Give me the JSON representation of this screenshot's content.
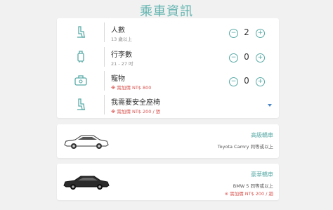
{
  "page": {
    "title": "乘車資訊"
  },
  "options": {
    "passengers": {
      "label": "人數",
      "sub": "13 歲以上",
      "value": "2",
      "minus": "−",
      "plus": "+",
      "icon": "car-seat-icon"
    },
    "luggage": {
      "label": "行李數",
      "sub": "21 - 27 吋",
      "value": "0",
      "minus": "−",
      "plus": "+",
      "icon": "luggage-icon"
    },
    "pets": {
      "label": "寵物",
      "note_mark": "※",
      "note": "需加價 NT$ 800",
      "value": "0",
      "minus": "−",
      "plus": "+",
      "icon": "pet-carrier-icon"
    },
    "child_seat": {
      "label": "我需要安全座椅",
      "note_mark": "※",
      "note": "需加價 NT$ 200 / 張",
      "icon": "child-seat-icon"
    }
  },
  "cars": [
    {
      "name": "高級轎車",
      "model": "Toyota Camry 同等或以上",
      "color": "#ffffff"
    },
    {
      "name": "豪華轎車",
      "model": "BMW 5 同等或以上",
      "note_mark": "※",
      "note": "需加價 NT$ 200 / 趟",
      "color": "#2b2b2b"
    }
  ],
  "colors": {
    "accent": "#5fb3ae",
    "warning": "#d9534f",
    "dropdown": "#4a86c8"
  }
}
